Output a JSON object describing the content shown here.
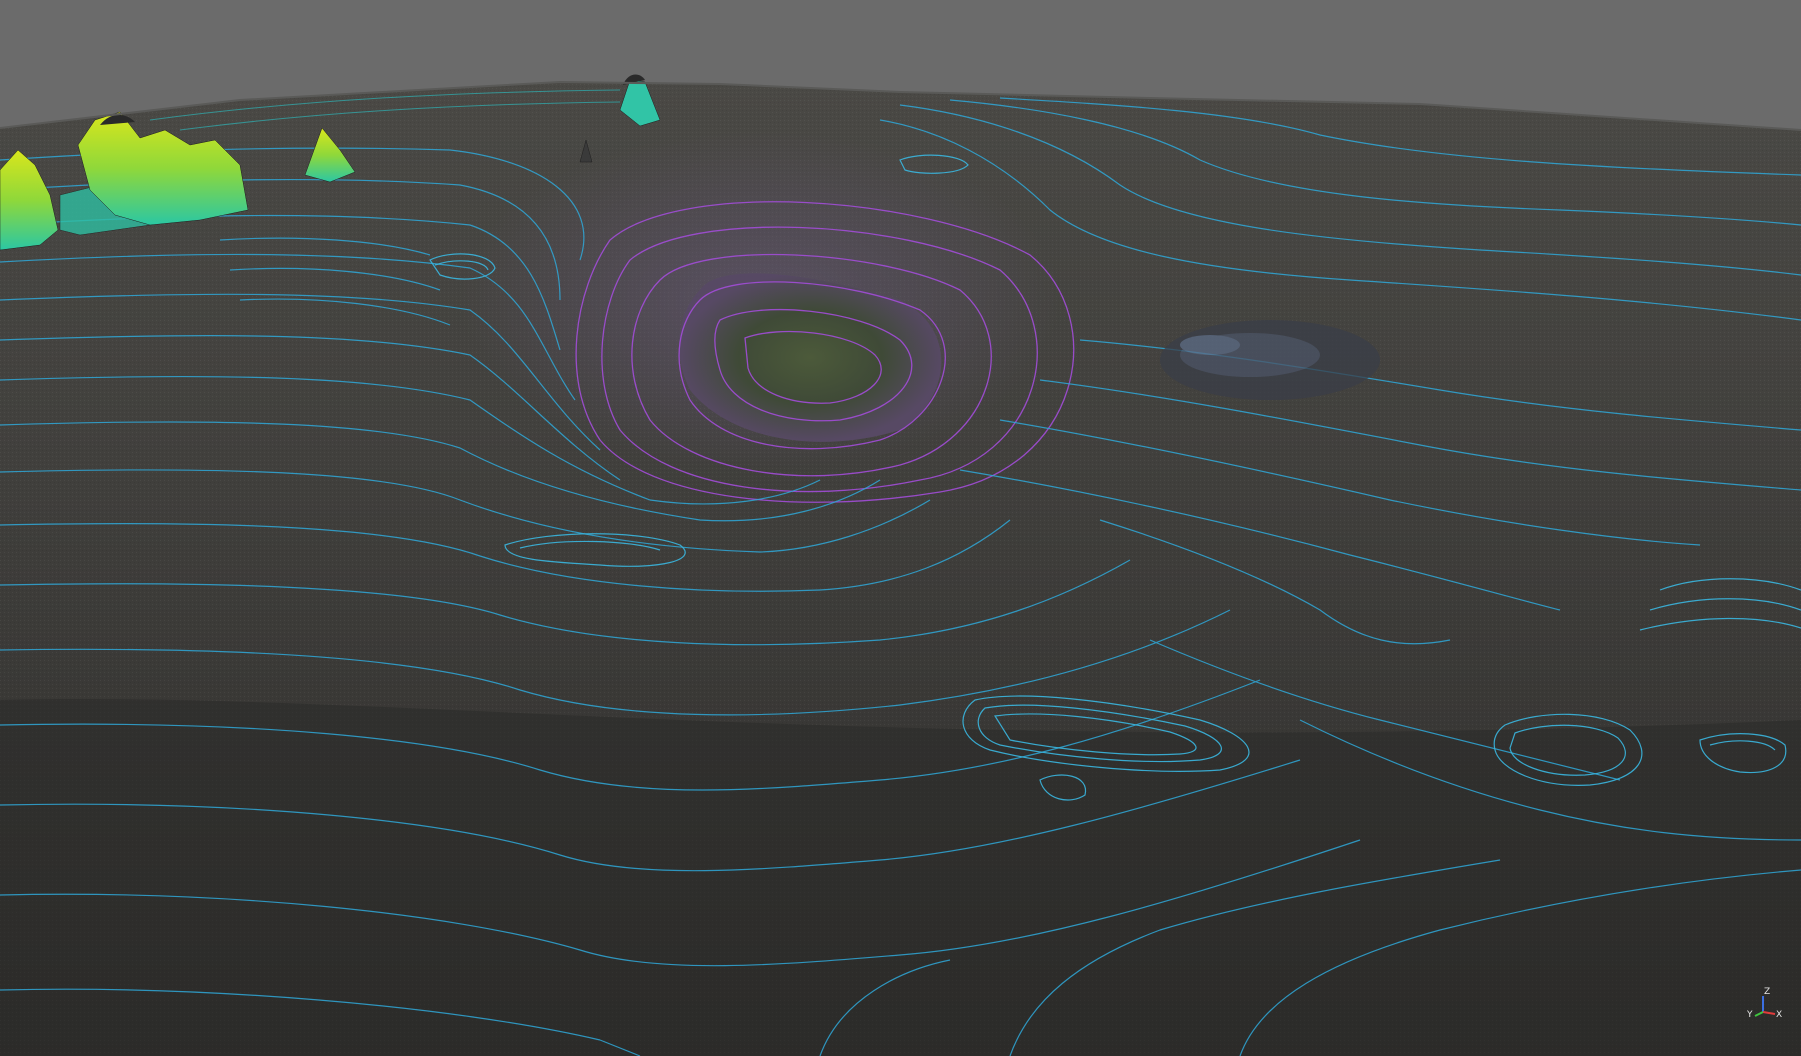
{
  "viewport": {
    "view_type": "3D point cloud with elevation contour lines",
    "colors": {
      "background": "#6e6e6e",
      "terrain": "#3a3937",
      "contour_low": "#2aa7d6",
      "contour_pit": "#9a3fd0",
      "point_cloud_high": "#b9e21d",
      "point_cloud_mid": "#26c9a4"
    }
  },
  "axis_gizmo": {
    "name": "axis-orientation-gizmo",
    "x_label": "X",
    "y_label": "Y",
    "z_label": "Z",
    "colors": {
      "x": "#e23b3b",
      "y": "#3fc43f",
      "z": "#3b6fe2"
    }
  }
}
